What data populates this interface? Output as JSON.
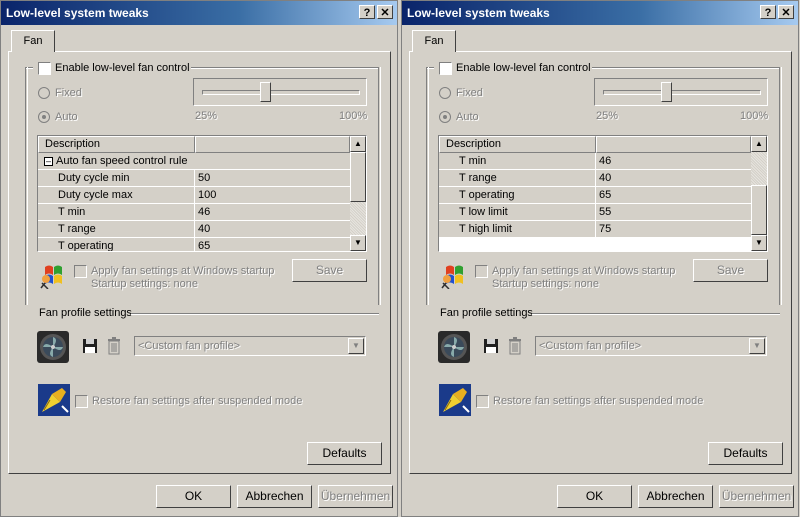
{
  "dialogs": [
    {
      "title": "Low-level system tweaks",
      "help_glyph": "?",
      "close_glyph": "✕",
      "tab": "Fan",
      "enable_label": "Enable low-level fan control",
      "fixed_label": "Fixed",
      "auto_label": "Auto",
      "slider_min_label": "25%",
      "slider_max_label": "100%",
      "slider_value_fraction": 0.4,
      "grid_header_description": "Description",
      "grid_rows": [
        {
          "type": "section",
          "name": "Auto fan speed control rule",
          "value": ""
        },
        {
          "type": "row",
          "name": "Duty cycle min",
          "value": "50"
        },
        {
          "type": "row",
          "name": "Duty cycle max",
          "value": "100"
        },
        {
          "type": "row",
          "name": "T min",
          "value": "46"
        },
        {
          "type": "row",
          "name": "T range",
          "value": "40"
        },
        {
          "type": "row",
          "name": "T operating",
          "value": "65"
        }
      ],
      "scroll_thumb_fraction": 0.0,
      "apply_label": "Apply fan settings at Windows startup",
      "startup_label": "Startup settings:  none",
      "save_label": "Save",
      "profile_group_label": "Fan profile settings",
      "profile_combo_value": "<Custom fan profile>",
      "restore_label": "Restore fan settings after suspended mode",
      "defaults_label": "Defaults",
      "ok_label": "OK",
      "cancel_label": "Abbrechen",
      "apply_button_label": "Übernehmen"
    },
    {
      "title": "Low-level system tweaks",
      "help_glyph": "?",
      "close_glyph": "✕",
      "tab": "Fan",
      "enable_label": "Enable low-level fan control",
      "fixed_label": "Fixed",
      "auto_label": "Auto",
      "slider_min_label": "25%",
      "slider_max_label": "100%",
      "slider_value_fraction": 0.4,
      "grid_header_description": "Description",
      "grid_rows": [
        {
          "type": "row",
          "name": "T min",
          "value": "46"
        },
        {
          "type": "row",
          "name": "T range",
          "value": "40"
        },
        {
          "type": "row",
          "name": "T operating",
          "value": "65"
        },
        {
          "type": "row",
          "name": "T low limit",
          "value": "55"
        },
        {
          "type": "row",
          "name": "T high limit",
          "value": "75"
        }
      ],
      "scroll_thumb_fraction": 1.0,
      "apply_label": "Apply fan settings at Windows startup",
      "startup_label": "Startup settings:  none",
      "save_label": "Save",
      "profile_group_label": "Fan profile settings",
      "profile_combo_value": "<Custom fan profile>",
      "restore_label": "Restore fan settings after suspended mode",
      "defaults_label": "Defaults",
      "ok_label": "OK",
      "cancel_label": "Abbrechen",
      "apply_button_label": "Übernehmen"
    }
  ]
}
